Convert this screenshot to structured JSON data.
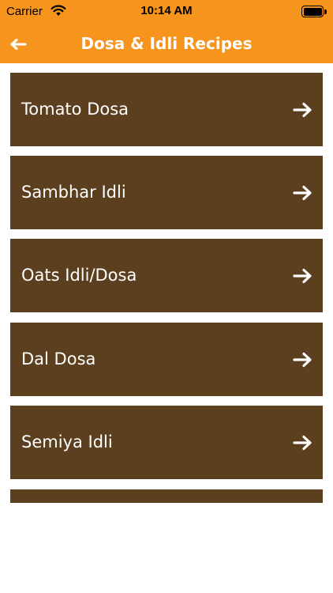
{
  "status_bar": {
    "carrier": "Carrier",
    "time": "10:14 AM",
    "wifi_icon": "wifi-icon",
    "battery_icon": "battery-icon"
  },
  "nav": {
    "title": "Dosa & Idli Recipes",
    "back_icon": "left-arrow-icon"
  },
  "recipes": [
    {
      "label": "Tomato Dosa",
      "icon": "right-arrow-icon"
    },
    {
      "label": "Sambhar Idli",
      "icon": "right-arrow-icon"
    },
    {
      "label": "Oats Idli/Dosa",
      "icon": "right-arrow-icon"
    },
    {
      "label": "Dal Dosa",
      "icon": "right-arrow-icon"
    },
    {
      "label": "Semiya Idli",
      "icon": "right-arrow-icon"
    },
    {
      "label": "",
      "icon": ""
    }
  ],
  "colors": {
    "header": "#F7941E",
    "row": "#5C3F1E",
    "row_text": "#FFFFFF",
    "background": "#FFFFFF"
  }
}
